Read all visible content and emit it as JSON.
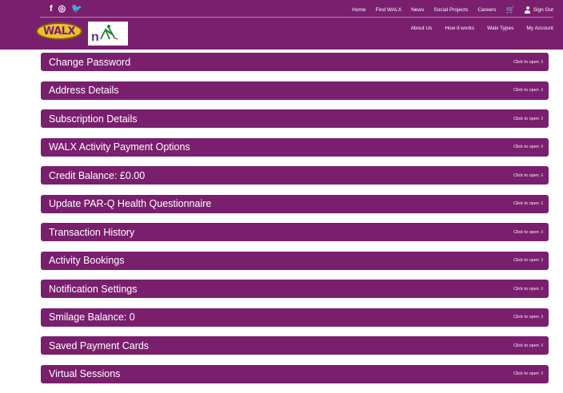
{
  "header": {
    "social": {
      "facebook": "f",
      "instagram": "◎",
      "twitter": "🐦"
    },
    "top_nav": [
      "Home",
      "Find WALX",
      "News",
      "Social Projects",
      "Careers"
    ],
    "cart_icon": "cart-icon",
    "sign_out_label": "Sign Out",
    "logo_text": "WALX",
    "secondary_nav": [
      "About Us",
      "How it works",
      "Walx Types",
      "My Account"
    ]
  },
  "accordion": {
    "hint": "Click to open ⇩",
    "items": [
      {
        "label": "Change Password"
      },
      {
        "label": "Address Details"
      },
      {
        "label": "Subscription Details"
      },
      {
        "label": "WALX Activity Payment Options"
      },
      {
        "label": "Credit Balance: £0.00"
      },
      {
        "label": "Update PAR-Q Health Questionnaire"
      },
      {
        "label": "Transaction History"
      },
      {
        "label": "Activity Bookings"
      },
      {
        "label": "Notification Settings"
      },
      {
        "label": "Smilage Balance: 0"
      },
      {
        "label": "Saved Payment Cards"
      },
      {
        "label": "Virtual Sessions"
      }
    ]
  },
  "colors": {
    "brand_purple": "#7a1f6e",
    "logo_yellow": "#e9c22a"
  }
}
